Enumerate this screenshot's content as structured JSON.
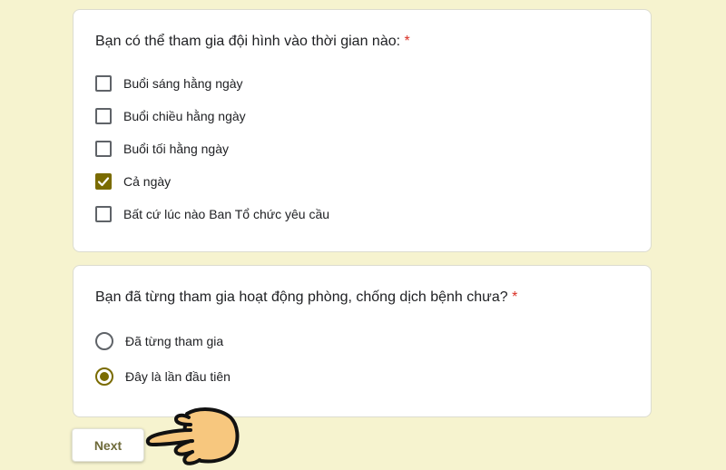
{
  "question1": {
    "text": "Bạn có thể tham gia đội hình vào thời gian nào:",
    "required_mark": "*",
    "options": [
      {
        "label": "Buổi sáng hằng ngày",
        "checked": false
      },
      {
        "label": "Buổi chiều hằng ngày",
        "checked": false
      },
      {
        "label": "Buổi tối hằng ngày",
        "checked": false
      },
      {
        "label": "Cả ngày",
        "checked": true
      },
      {
        "label": "Bất cứ lúc nào Ban Tổ chức yêu cầu",
        "checked": false
      }
    ]
  },
  "question2": {
    "text": "Bạn đã từng tham gia hoạt động phòng, chống dịch bệnh chưa?",
    "required_mark": "*",
    "options": [
      {
        "label": "Đã từng tham gia",
        "selected": false
      },
      {
        "label": "Đây là lần đầu tiên",
        "selected": true
      }
    ]
  },
  "next_label": "Next",
  "colors": {
    "background": "#f6f3cf",
    "accent": "#7a6b00",
    "required": "#d93025",
    "hand_fill": "#f7c77e"
  },
  "icons": {
    "pointer": "pointing-hand-icon",
    "check": "checkmark-icon"
  }
}
